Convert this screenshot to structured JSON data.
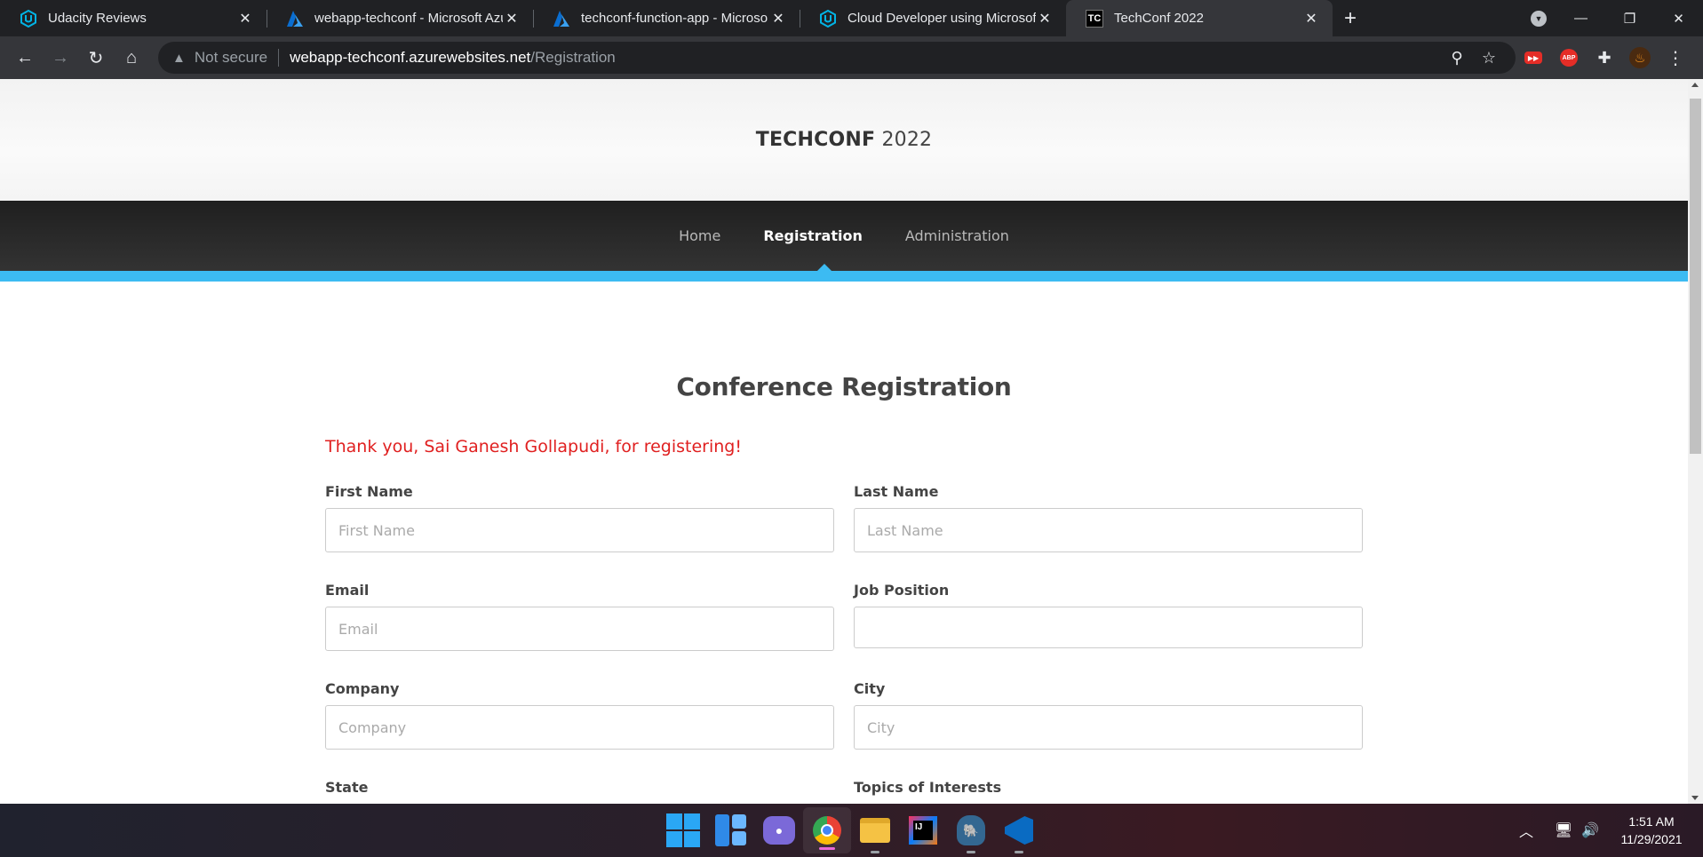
{
  "browser": {
    "tabs": [
      {
        "title": "Udacity Reviews",
        "favicon": "udacity-icon",
        "active": false
      },
      {
        "title": "webapp-techconf - Microsoft Azu",
        "favicon": "azure-icon",
        "active": false
      },
      {
        "title": "techconf-function-app - Microso",
        "favicon": "azure-icon",
        "active": false
      },
      {
        "title": "Cloud Developer using Microsoft",
        "favicon": "udacity-icon",
        "active": false
      },
      {
        "title": "TechConf 2022",
        "favicon": "techconf-icon",
        "favicon_text": "TC",
        "active": true
      }
    ],
    "address_bar": {
      "security_label": "Not secure",
      "host": "webapp-techconf.azurewebsites.net",
      "path": "/Registration"
    }
  },
  "site": {
    "logo_brand": "TECHCONF",
    "logo_year": "2022",
    "nav": [
      {
        "label": "Home",
        "active": false
      },
      {
        "label": "Registration",
        "active": true
      },
      {
        "label": "Administration",
        "active": false
      }
    ],
    "accent_color": "#3cbbf2"
  },
  "page": {
    "title": "Conference Registration",
    "success_message": "Thank you, Sai Ganesh Gollapudi, for registering!",
    "success_color": "#e02020",
    "form": {
      "first_name": {
        "label": "First Name",
        "placeholder": "First Name",
        "value": ""
      },
      "last_name": {
        "label": "Last Name",
        "placeholder": "Last Name",
        "value": ""
      },
      "email": {
        "label": "Email",
        "placeholder": "Email",
        "value": ""
      },
      "job_position": {
        "label": "Job Position",
        "placeholder": "",
        "value": ""
      },
      "company": {
        "label": "Company",
        "placeholder": "Company",
        "value": ""
      },
      "city": {
        "label": "City",
        "placeholder": "City",
        "value": ""
      },
      "state": {
        "label": "State"
      },
      "topics": {
        "label": "Topics of Interests"
      }
    }
  },
  "taskbar": {
    "apps": [
      "windows-start-icon",
      "widgets-icon",
      "teams-chat-icon",
      "chrome-icon",
      "file-explorer-icon",
      "intellij-icon",
      "pgadmin-icon",
      "vscode-icon"
    ],
    "time": "1:51 AM",
    "date": "11/29/2021"
  }
}
